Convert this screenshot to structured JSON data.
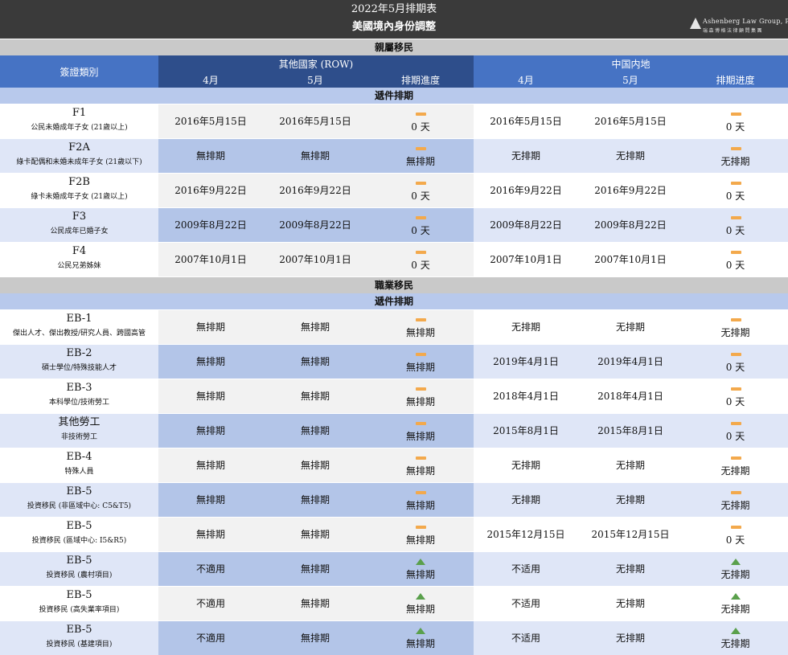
{
  "header": {
    "title": "2022年5月排期表",
    "subtitle": "美國境內身份調整",
    "logo_line1": "Ashenberg Law Group, P.C.",
    "logo_line2": "瑞森博格法律顧問集團"
  },
  "columns": {
    "visa_type": "簽證類別",
    "row_group": "其他國家 (ROW)",
    "cn_group": "中国内地",
    "row_month1": "4月",
    "row_month2": "5月",
    "row_progress": "排期進度",
    "cn_month1": "4月",
    "cn_month2": "5月",
    "cn_progress": "排期进度"
  },
  "family": {
    "section_title": "親屬移民",
    "sub_title": "遞件排期",
    "rows": [
      {
        "code": "F1",
        "desc": "公民未婚成年子女 (21歲以上)",
        "row_apr": "2016年5月15日",
        "row_may": "2016年5月15日",
        "row_icon": "dash-icon",
        "row_progress": "0 天",
        "cn_apr": "2016年5月15日",
        "cn_may": "2016年5月15日",
        "cn_icon": "dash-icon",
        "cn_progress": "0 天"
      },
      {
        "code": "F2A",
        "desc": "綠卡配偶和未婚未成年子女 (21歲以下)",
        "row_apr": "無排期",
        "row_may": "無排期",
        "row_icon": "dash-icon",
        "row_progress": "無排期",
        "cn_apr": "无排期",
        "cn_may": "无排期",
        "cn_icon": "dash-icon",
        "cn_progress": "无排期"
      },
      {
        "code": "F2B",
        "desc": "綠卡未婚成年子女 (21歲以上)",
        "row_apr": "2016年9月22日",
        "row_may": "2016年9月22日",
        "row_icon": "dash-icon",
        "row_progress": "0 天",
        "cn_apr": "2016年9月22日",
        "cn_may": "2016年9月22日",
        "cn_icon": "dash-icon",
        "cn_progress": "0 天"
      },
      {
        "code": "F3",
        "desc": "公民成年已婚子女",
        "row_apr": "2009年8月22日",
        "row_may": "2009年8月22日",
        "row_icon": "dash-icon",
        "row_progress": "0 天",
        "cn_apr": "2009年8月22日",
        "cn_may": "2009年8月22日",
        "cn_icon": "dash-icon",
        "cn_progress": "0 天"
      },
      {
        "code": "F4",
        "desc": "公民兄弟姊妹",
        "row_apr": "2007年10月1日",
        "row_may": "2007年10月1日",
        "row_icon": "dash-icon",
        "row_progress": "0 天",
        "cn_apr": "2007年10月1日",
        "cn_may": "2007年10月1日",
        "cn_icon": "dash-icon",
        "cn_progress": "0 天"
      }
    ]
  },
  "employment": {
    "section_title": "職業移民",
    "sub_title": "遞件排期",
    "rows": [
      {
        "code": "EB-1",
        "desc": "傑出人才、傑出教授/研究人員、跨國高管",
        "row_apr": "無排期",
        "row_may": "無排期",
        "row_icon": "dash-icon",
        "row_progress": "無排期",
        "cn_apr": "无排期",
        "cn_may": "无排期",
        "cn_icon": "dash-icon",
        "cn_progress": "无排期"
      },
      {
        "code": "EB-2",
        "desc": "碩士學位/特殊技能人才",
        "row_apr": "無排期",
        "row_may": "無排期",
        "row_icon": "dash-icon",
        "row_progress": "無排期",
        "cn_apr": "2019年4月1日",
        "cn_may": "2019年4月1日",
        "cn_icon": "dash-icon",
        "cn_progress": "0 天"
      },
      {
        "code": "EB-3",
        "desc": "本科學位/技術勞工",
        "row_apr": "無排期",
        "row_may": "無排期",
        "row_icon": "dash-icon",
        "row_progress": "無排期",
        "cn_apr": "2018年4月1日",
        "cn_may": "2018年4月1日",
        "cn_icon": "dash-icon",
        "cn_progress": "0 天"
      },
      {
        "code": "其他勞工",
        "desc": "非技術勞工",
        "row_apr": "無排期",
        "row_may": "無排期",
        "row_icon": "dash-icon",
        "row_progress": "無排期",
        "cn_apr": "2015年8月1日",
        "cn_may": "2015年8月1日",
        "cn_icon": "dash-icon",
        "cn_progress": "0 天"
      },
      {
        "code": "EB-4",
        "desc": "特殊人員",
        "row_apr": "無排期",
        "row_may": "無排期",
        "row_icon": "dash-icon",
        "row_progress": "無排期",
        "cn_apr": "无排期",
        "cn_may": "无排期",
        "cn_icon": "dash-icon",
        "cn_progress": "无排期"
      },
      {
        "code": "EB-5",
        "desc": "投資移民 (非區域中心: C5&T5)",
        "row_apr": "無排期",
        "row_may": "無排期",
        "row_icon": "dash-icon",
        "row_progress": "無排期",
        "cn_apr": "无排期",
        "cn_may": "无排期",
        "cn_icon": "dash-icon",
        "cn_progress": "无排期"
      },
      {
        "code": "EB-5",
        "desc": "投資移民 (區域中心: I5&R5)",
        "row_apr": "無排期",
        "row_may": "無排期",
        "row_icon": "dash-icon",
        "row_progress": "無排期",
        "cn_apr": "2015年12月15日",
        "cn_may": "2015年12月15日",
        "cn_icon": "dash-icon",
        "cn_progress": "0 天"
      },
      {
        "code": "EB-5",
        "desc": "投資移民 (農村項目)",
        "row_apr": "不適用",
        "row_may": "無排期",
        "row_icon": "up-arrow-icon",
        "row_progress": "無排期",
        "cn_apr": "不适用",
        "cn_may": "无排期",
        "cn_icon": "up-arrow-icon",
        "cn_progress": "无排期"
      },
      {
        "code": "EB-5",
        "desc": "投資移民 (高失業率項目)",
        "row_apr": "不適用",
        "row_may": "無排期",
        "row_icon": "up-arrow-icon",
        "row_progress": "無排期",
        "cn_apr": "不适用",
        "cn_may": "无排期",
        "cn_icon": "up-arrow-icon",
        "cn_progress": "无排期"
      },
      {
        "code": "EB-5",
        "desc": "投資移民 (基建項目)",
        "row_apr": "不適用",
        "row_may": "無排期",
        "row_icon": "up-arrow-icon",
        "row_progress": "無排期",
        "cn_apr": "不适用",
        "cn_may": "无排期",
        "cn_icon": "up-arrow-icon",
        "cn_progress": "无排期"
      }
    ]
  },
  "colors": {
    "header_bg": "#3a3a3a",
    "row_group_bg": "#2e4e8b",
    "blue_header": "#4673c4",
    "dash": "#f3a94c",
    "arrow": "#5aa04c"
  }
}
